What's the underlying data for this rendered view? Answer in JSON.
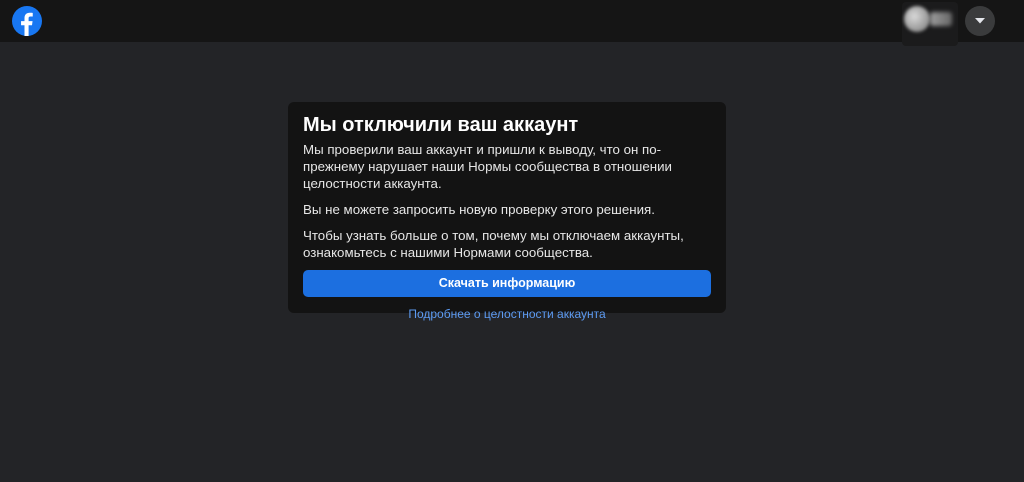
{
  "header": {
    "logo_icon": "facebook-logo-icon",
    "brand_color": "#1877f2",
    "menu_icon": "caret-down-icon"
  },
  "notice": {
    "title": "Мы отключили ваш аккаунт",
    "paragraph_1": "Мы проверили ваш аккаунт и пришли к выводу, что он по-прежнему нарушает наши Нормы сообщества в отношении целостности аккаунта.",
    "paragraph_2": "Вы не можете запросить новую проверку этого решения.",
    "paragraph_3": "Чтобы узнать больше о том, почему мы отключаем аккаунты, ознакомьтесь с нашими Нормами сообщества.",
    "download_label": "Скачать информацию",
    "more_link_label": "Подробнее о целостности аккаунта",
    "accent_color": "#1c6fe0",
    "link_color": "#5d9bf2"
  }
}
